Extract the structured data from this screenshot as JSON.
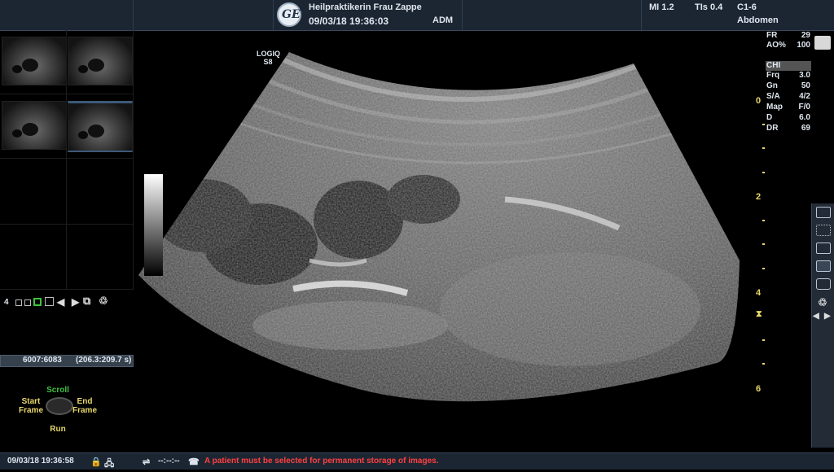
{
  "header": {
    "facility": "Heilpraktikerin Frau Zappe",
    "datetime": "09/03/18 19:36:03",
    "operator": "ADM",
    "mi": "MI 1.2",
    "tis": "TIs 0.4",
    "probe": "C1-6",
    "preset": "Abdomen",
    "logo_text": "GE"
  },
  "probe_label": {
    "line1": "LOGIQ",
    "line2": "S8"
  },
  "params": [
    {
      "k": "FR",
      "v": "29"
    },
    {
      "k": "AO%",
      "v": "100"
    },
    {
      "k": "Frq",
      "v": "3.0"
    },
    {
      "k": "Gn",
      "v": "50"
    },
    {
      "k": "S/A",
      "v": "4/2"
    },
    {
      "k": "Map",
      "v": "F/0"
    },
    {
      "k": "D",
      "v": "6.0"
    },
    {
      "k": "DR",
      "v": "69"
    }
  ],
  "mode": "CHI",
  "depth_labels": [
    "0",
    "2",
    "4",
    "6"
  ],
  "thumbnails": {
    "page_number": "4"
  },
  "cine": {
    "frames": "6007:6083",
    "time": "(206.3:209.7 s)"
  },
  "trackball": {
    "top": "Scroll",
    "left_line1": "Start",
    "left_line2": "Frame",
    "right_line1": "End",
    "right_line2": "Frame",
    "bottom": "Run"
  },
  "status": {
    "datetime": "09/03/18 19:36:58",
    "timer": "--:--:--",
    "message": "A patient must be selected for permanent storage of images."
  },
  "colors": {
    "accent_yellow": "#e8d86a",
    "scroll_green": "#40c040",
    "alert_red": "#ff4040"
  }
}
